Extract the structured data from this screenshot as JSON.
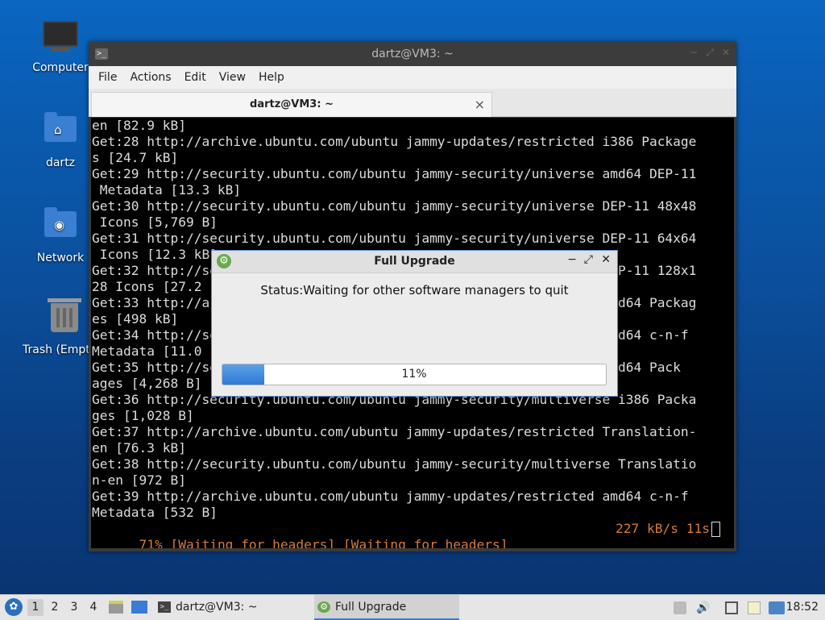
{
  "desktop": {
    "icons": [
      {
        "label": "Computer",
        "icon": "computer-icon"
      },
      {
        "label": "dartz",
        "icon": "home-folder-icon"
      },
      {
        "label": "Network",
        "icon": "network-folder-icon"
      },
      {
        "label": "Trash (Empt",
        "icon": "trash-icon"
      }
    ]
  },
  "terminal": {
    "window_title": "dartz@VM3: ~",
    "menu": [
      "File",
      "Actions",
      "Edit",
      "View",
      "Help"
    ],
    "tab_title": "dartz@VM3: ~",
    "tab_close": "×",
    "lines": [
      "en [82.9 kB]",
      "Get:28 http://archive.ubuntu.com/ubuntu jammy-updates/restricted i386 Package",
      "s [24.7 kB]",
      "Get:29 http://security.ubuntu.com/ubuntu jammy-security/universe amd64 DEP-11",
      " Metadata [13.3 kB]",
      "Get:30 http://security.ubuntu.com/ubuntu jammy-security/universe DEP-11 48x48",
      " Icons [5,769 B]",
      "Get:31 http://security.ubuntu.com/ubuntu jammy-security/universe DEP-11 64x64",
      " Icons [12.3 kB]",
      "Get:32 http://security.ubuntu.com/ubuntu jammy-security/universe DEP-11 128x1",
      "28 Icons [27.2 kB]",
      "Get:33 http://archive.ubuntu.com/ubuntu jammy-updates/restricted amd64 Packag",
      "es [498 kB]",
      "Get:34 http://security.ubuntu.com/ubuntu jammy-security/universe amd64 c-n-f",
      "Metadata [11.0 kB]",
      "Get:35 http://security.ubuntu.com/ubuntu jammy-security/universe amd64 Pack",
      "ages [4,268 B]",
      "Get:36 http://security.ubuntu.com/ubuntu jammy-security/multiverse i386 Packa",
      "ges [1,028 B]",
      "Get:37 http://archive.ubuntu.com/ubuntu jammy-updates/restricted Translation-",
      "en [76.3 kB]",
      "Get:38 http://security.ubuntu.com/ubuntu jammy-security/multiverse Translatio",
      "n-en [972 B]",
      "Get:39 http://archive.ubuntu.com/ubuntu jammy-updates/restricted amd64 c-n-f",
      "Metadata [532 B]"
    ],
    "status_left": "71% [Waiting for headers] [Waiting for headers]",
    "status_right": "227 kB/s 11s"
  },
  "dialog": {
    "title": "Full Upgrade",
    "status": "Status:Waiting for other software managers to quit",
    "progress_percent": 11,
    "progress_label": "11%",
    "controls": {
      "minimize": "−",
      "maximize": "⤢",
      "close": "✕"
    }
  },
  "taskbar": {
    "workspaces": [
      "1",
      "2",
      "3",
      "4"
    ],
    "active_workspace": "1",
    "tasks": [
      {
        "label": "dartz@VM3: ~",
        "icon": "terminal-icon"
      },
      {
        "label": "Full Upgrade",
        "icon": "gear-icon"
      }
    ],
    "clock": "18:52"
  }
}
